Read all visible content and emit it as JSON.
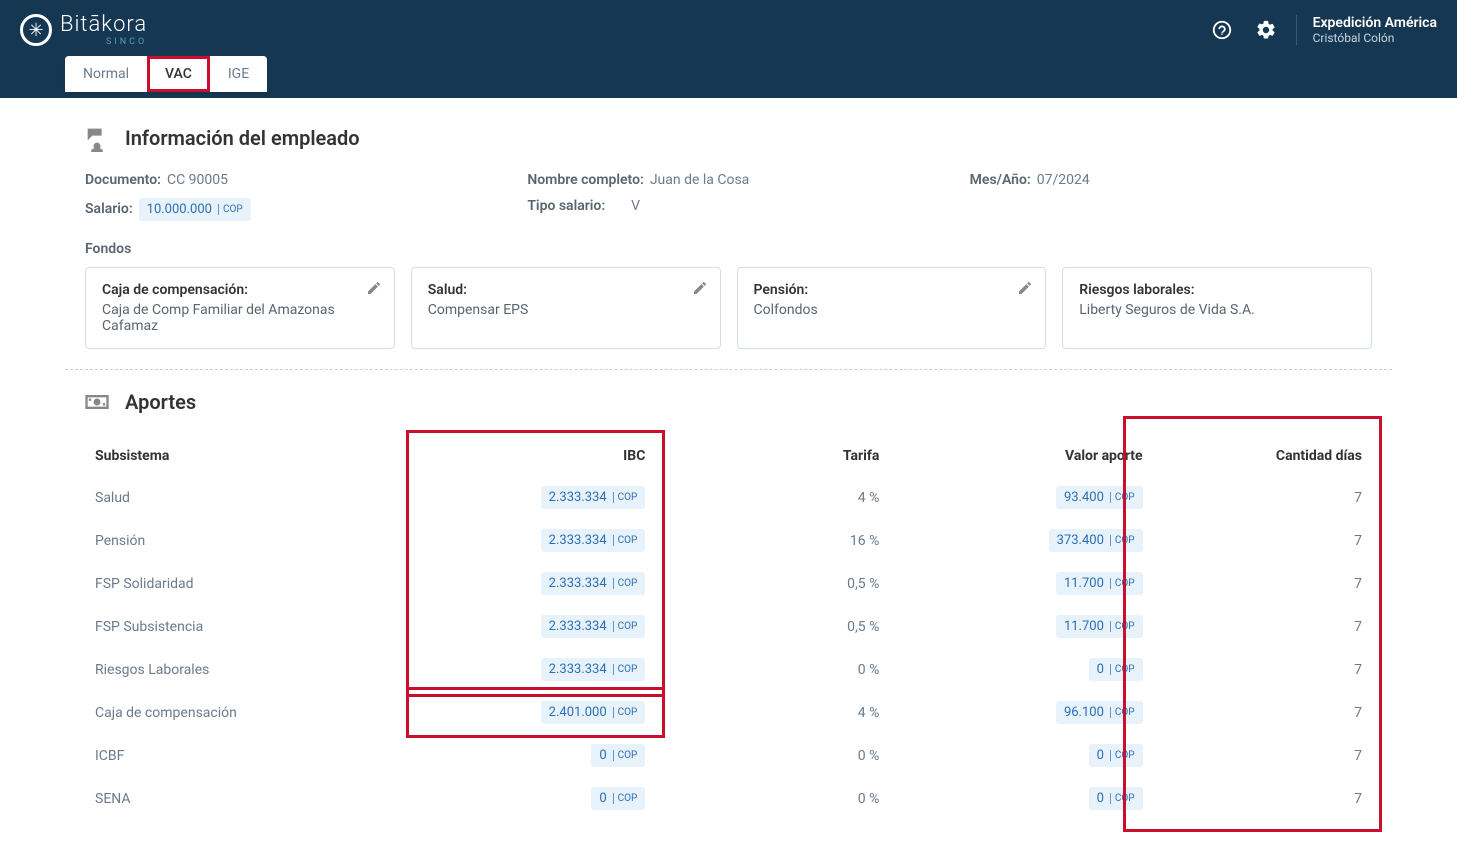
{
  "app": {
    "name": "Bitākora",
    "sub": "SINCO"
  },
  "user": {
    "org": "Expedición América",
    "name": "Cristóbal Colón"
  },
  "tabs": [
    {
      "label": "Normal",
      "active": false,
      "hl": false
    },
    {
      "label": "VAC",
      "active": true,
      "hl": true
    },
    {
      "label": "IGE",
      "active": false,
      "hl": false
    }
  ],
  "employee_section": {
    "title": "Información del empleado",
    "doc_label": "Documento:",
    "doc_value": "CC 90005",
    "name_label": "Nombre completo:",
    "name_value": "Juan de la Cosa",
    "period_label": "Mes/Año:",
    "period_value": "07/2024",
    "salary_label": "Salario:",
    "salary_value": "10.000.000",
    "currency": "COP",
    "salary_type_label": "Tipo salario:",
    "salary_type_value": "V",
    "fondos_label": "Fondos"
  },
  "funds": [
    {
      "label": "Caja de compensación:",
      "value": "Caja de Comp Familiar del Amazonas Cafamaz",
      "editable": true
    },
    {
      "label": "Salud:",
      "value": "Compensar EPS",
      "editable": true
    },
    {
      "label": "Pensión:",
      "value": "Colfondos",
      "editable": true
    },
    {
      "label": "Riesgos laborales:",
      "value": "Liberty Seguros de Vida S.A.",
      "editable": false
    }
  ],
  "aportes_section": {
    "title": "Aportes"
  },
  "table": {
    "headers": {
      "sub": "Subsistema",
      "ibc": "IBC",
      "tarifa": "Tarifa",
      "valor": "Valor aporte",
      "dias": "Cantidad días"
    },
    "currency": "COP",
    "rows": [
      {
        "sub": "Salud",
        "ibc": "2.333.334",
        "tarifa": "4 %",
        "valor": "93.400",
        "dias": "7"
      },
      {
        "sub": "Pensión",
        "ibc": "2.333.334",
        "tarifa": "16 %",
        "valor": "373.400",
        "dias": "7"
      },
      {
        "sub": "FSP Solidaridad",
        "ibc": "2.333.334",
        "tarifa": "0,5 %",
        "valor": "11.700",
        "dias": "7"
      },
      {
        "sub": "FSP Subsistencia",
        "ibc": "2.333.334",
        "tarifa": "0,5 %",
        "valor": "11.700",
        "dias": "7"
      },
      {
        "sub": "Riesgos Laborales",
        "ibc": "2.333.334",
        "tarifa": "0 %",
        "valor": "0",
        "dias": "7"
      },
      {
        "sub": "Caja de compensación",
        "ibc": "2.401.000",
        "tarifa": "4 %",
        "valor": "96.100",
        "dias": "7"
      },
      {
        "sub": "ICBF",
        "ibc": "0",
        "tarifa": "0 %",
        "valor": "0",
        "dias": "7"
      },
      {
        "sub": "SENA",
        "ibc": "0",
        "tarifa": "0 %",
        "valor": "0",
        "dias": "7"
      }
    ]
  }
}
